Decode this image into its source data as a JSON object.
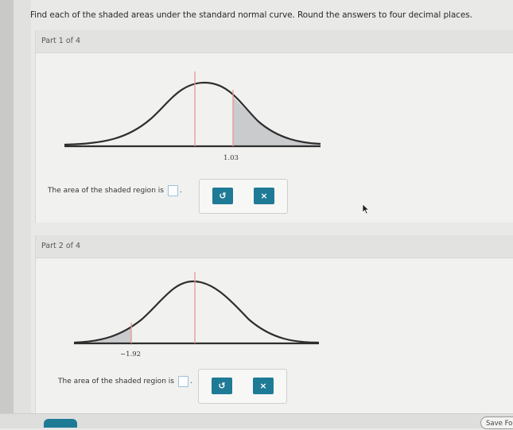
{
  "instructions": "Find each of the shaded areas under the standard normal curve. Round the answers to four decimal places.",
  "parts": [
    {
      "header": "Part 1 of 4",
      "z_label": "1.03",
      "prompt": "The area of the shaded region is",
      "prompt_end": "."
    },
    {
      "header": "Part 2 of 4",
      "z_label": "−1.92",
      "prompt": "The area of the shaded region is",
      "prompt_end": "."
    }
  ],
  "tools": {
    "undo_icon": "↺",
    "clear_icon": "×"
  },
  "footer": {
    "save_label": "Save Fo"
  },
  "colors": {
    "accent": "#1f7a96",
    "mean_line": "#e89a8e",
    "shade": "#c9cbcd"
  }
}
